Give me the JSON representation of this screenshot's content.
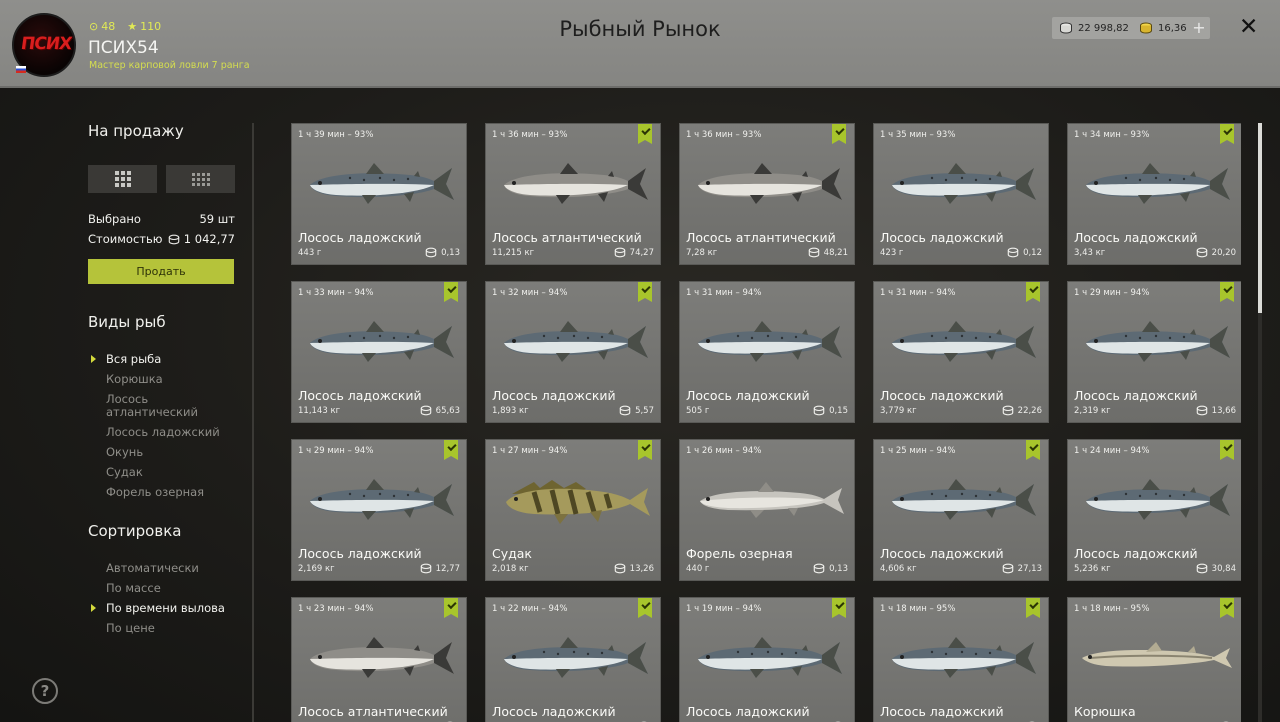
{
  "header": {
    "title": "Рыбный Рынок",
    "avatar_text": "ПСИХ",
    "username": "ПСИХ54",
    "rank": "Мастер карповой ловли 7 ранга",
    "stat_coins": "48",
    "stat_stars": "110",
    "silver": "22 998,82",
    "gold": "16,36",
    "plus": "+",
    "close": "✕"
  },
  "sidebar": {
    "for_sale_title": "На продажу",
    "selected_label": "Выбрано",
    "selected_value": "59 шт",
    "cost_label": "Стоимостью",
    "cost_value": "1 042,77",
    "sell_button": "Продать",
    "species_title": "Виды рыб",
    "species": [
      "Вся рыба",
      "Корюшка",
      "Лосось\nатлантический",
      "Лосось ладожский",
      "Окунь",
      "Судак",
      "Форель озерная"
    ],
    "sort_title": "Сортировка",
    "sort_options": [
      "Автоматически",
      "По массе",
      "По времени вылова",
      "По цене"
    ],
    "help": "?"
  },
  "colors": {
    "accent": "#b5c33a",
    "check": "#a8c52c",
    "header_bg": "#8a8a87",
    "card_bg": "#777774"
  },
  "cards": [
    {
      "time": "1 ч 39 мин – 93%",
      "name": "Лосось ладожский",
      "weight": "443 г",
      "price": "0,13",
      "checked": false,
      "fish": "salmon-ladoga"
    },
    {
      "time": "1 ч 36 мин – 93%",
      "name": "Лосось атлантический",
      "weight": "11,215 кг",
      "price": "74,27",
      "checked": true,
      "fish": "salmon-atlantic"
    },
    {
      "time": "1 ч 36 мин – 93%",
      "name": "Лосось атлантический",
      "weight": "7,28 кг",
      "price": "48,21",
      "checked": true,
      "fish": "salmon-atlantic"
    },
    {
      "time": "1 ч 35 мин – 93%",
      "name": "Лосось ладожский",
      "weight": "423 г",
      "price": "0,12",
      "checked": false,
      "fish": "salmon-ladoga"
    },
    {
      "time": "1 ч 34 мин – 93%",
      "name": "Лосось ладожский",
      "weight": "3,43 кг",
      "price": "20,20",
      "checked": true,
      "fish": "salmon-ladoga"
    },
    {
      "time": "1 ч 33 мин – 94%",
      "name": "Лосось ладожский",
      "weight": "11,143 кг",
      "price": "65,63",
      "checked": true,
      "fish": "salmon-ladoga"
    },
    {
      "time": "1 ч 32 мин – 94%",
      "name": "Лосось ладожский",
      "weight": "1,893 кг",
      "price": "5,57",
      "checked": true,
      "fish": "salmon-ladoga"
    },
    {
      "time": "1 ч 31 мин – 94%",
      "name": "Лосось ладожский",
      "weight": "505 г",
      "price": "0,15",
      "checked": false,
      "fish": "salmon-ladoga"
    },
    {
      "time": "1 ч 31 мин – 94%",
      "name": "Лосось ладожский",
      "weight": "3,779 кг",
      "price": "22,26",
      "checked": true,
      "fish": "salmon-ladoga"
    },
    {
      "time": "1 ч 29 мин – 94%",
      "name": "Лосось ладожский",
      "weight": "2,319 кг",
      "price": "13,66",
      "checked": true,
      "fish": "salmon-ladoga"
    },
    {
      "time": "1 ч 29 мин – 94%",
      "name": "Лосось ладожский",
      "weight": "2,169 кг",
      "price": "12,77",
      "checked": true,
      "fish": "salmon-ladoga"
    },
    {
      "time": "1 ч 27 мин – 94%",
      "name": "Судак",
      "weight": "2,018 кг",
      "price": "13,26",
      "checked": true,
      "fish": "zander"
    },
    {
      "time": "1 ч 26 мин – 94%",
      "name": "Форель озерная",
      "weight": "440 г",
      "price": "0,13",
      "checked": false,
      "fish": "trout"
    },
    {
      "time": "1 ч 25 мин – 94%",
      "name": "Лосось ладожский",
      "weight": "4,606 кг",
      "price": "27,13",
      "checked": true,
      "fish": "salmon-ladoga"
    },
    {
      "time": "1 ч 24 мин – 94%",
      "name": "Лосось ладожский",
      "weight": "5,236 кг",
      "price": "30,84",
      "checked": true,
      "fish": "salmon-ladoga"
    },
    {
      "time": "1 ч 23 мин – 94%",
      "name": "Лосось атлантический",
      "weight": "",
      "price": "",
      "checked": true,
      "fish": "salmon-atlantic"
    },
    {
      "time": "1 ч 22 мин – 94%",
      "name": "Лосось ладожский",
      "weight": "",
      "price": "",
      "checked": true,
      "fish": "salmon-ladoga"
    },
    {
      "time": "1 ч 19 мин – 94%",
      "name": "Лосось ладожский",
      "weight": "",
      "price": "",
      "checked": true,
      "fish": "salmon-ladoga"
    },
    {
      "time": "1 ч 18 мин – 95%",
      "name": "Лосось ладожский",
      "weight": "",
      "price": "",
      "checked": true,
      "fish": "salmon-ladoga"
    },
    {
      "time": "1 ч 18 мин – 95%",
      "name": "Корюшка",
      "weight": "",
      "price": "",
      "checked": true,
      "fish": "smelt"
    }
  ]
}
